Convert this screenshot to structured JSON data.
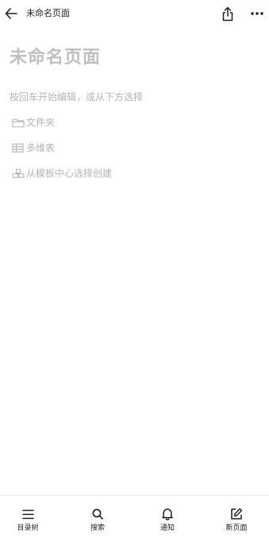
{
  "header": {
    "title": "未命名页面",
    "icons": {
      "back": "back-arrow-icon",
      "share": "share-icon",
      "more": "more-icon"
    }
  },
  "page": {
    "title": "未命名页面",
    "hint": "按回车开始编辑，或从下方选择"
  },
  "options": [
    {
      "label": "文件夹",
      "icon": "folder-icon"
    },
    {
      "label": "多维表",
      "icon": "table-icon"
    },
    {
      "label": "从模板中心选择创建",
      "icon": "template-icon"
    }
  ],
  "bottom_nav": [
    {
      "label": "目录树",
      "icon": "menu-icon"
    },
    {
      "label": "搜索",
      "icon": "search-icon"
    },
    {
      "label": "通知",
      "icon": "bell-icon"
    },
    {
      "label": "新页面",
      "icon": "new-page-icon"
    }
  ],
  "colors": {
    "text": "#1f1f1f",
    "placeholder": "#b5b5b5",
    "title_placeholder": "#bfbfbf"
  }
}
